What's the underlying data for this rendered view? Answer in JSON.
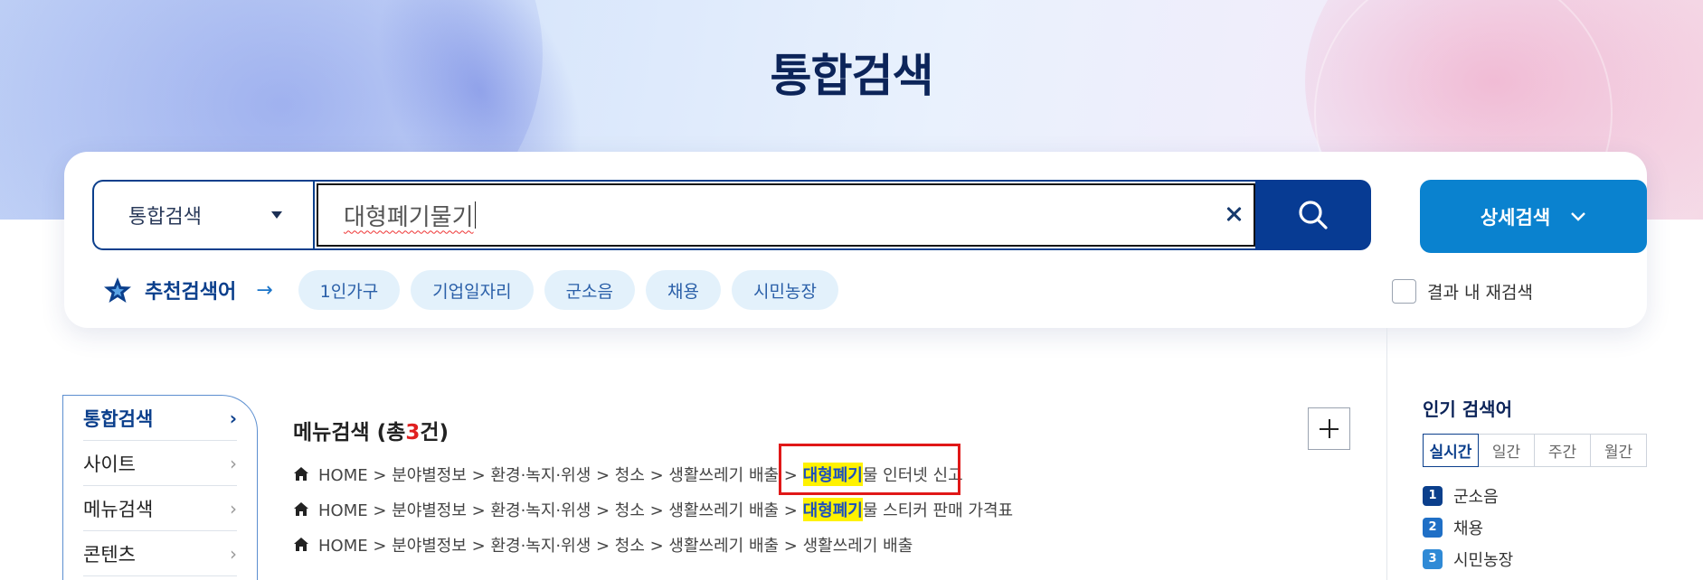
{
  "page": {
    "title": "통합검색"
  },
  "search": {
    "scope_selected": "통합검색",
    "query": "대형폐기물기",
    "advanced_label": "상세검색",
    "recheck_label": "결과 내 재검색"
  },
  "recommended": {
    "label": "추천검색어",
    "arrow": "→",
    "keywords": [
      "1인가구",
      "기업일자리",
      "군소음",
      "채용",
      "시민농장"
    ]
  },
  "sidebar": {
    "items": [
      {
        "label": "통합검색",
        "chevron": "›"
      },
      {
        "label": "사이트",
        "chevron": "›"
      },
      {
        "label": "메뉴검색",
        "chevron": "›"
      },
      {
        "label": "콘텐츠",
        "chevron": "›"
      }
    ]
  },
  "menu_results": {
    "title_prefix": "메뉴검색 (총",
    "count": "3",
    "title_suffix": "건)",
    "rows": [
      {
        "path": "HOME > 분야별정보 > 환경·녹지·위생 > 청소 > 생활쓰레기 배출 > ",
        "highlight": "대형폐기",
        "rest": "물 인터넷 신고"
      },
      {
        "path": "HOME > 분야별정보 > 환경·녹지·위생 > 청소 > 생활쓰레기 배출 > ",
        "highlight": "대형폐기",
        "rest": "물 스티커 판매 가격표"
      },
      {
        "path": "HOME > 분야별정보 > 환경·녹지·위생 > 청소 > 생활쓰레기 배출 > ",
        "highlight": "",
        "rest": "생활쓰레기 배출"
      }
    ]
  },
  "popular": {
    "title": "인기 검색어",
    "tabs": [
      "실시간",
      "일간",
      "주간",
      "월간"
    ],
    "ranks": [
      {
        "num": "1",
        "term": "군소음",
        "color": "#0b3f8c"
      },
      {
        "num": "2",
        "term": "채용",
        "color": "#1f6fc6"
      },
      {
        "num": "3",
        "term": "시민농장",
        "color": "#2f8ad6"
      }
    ]
  },
  "colors": {
    "primary_navy": "#0b3f8c",
    "search_button": "#073b93",
    "advanced_button": "#0a82cf",
    "highlight_yellow": "#fff200",
    "annotation_red": "#e01818"
  }
}
